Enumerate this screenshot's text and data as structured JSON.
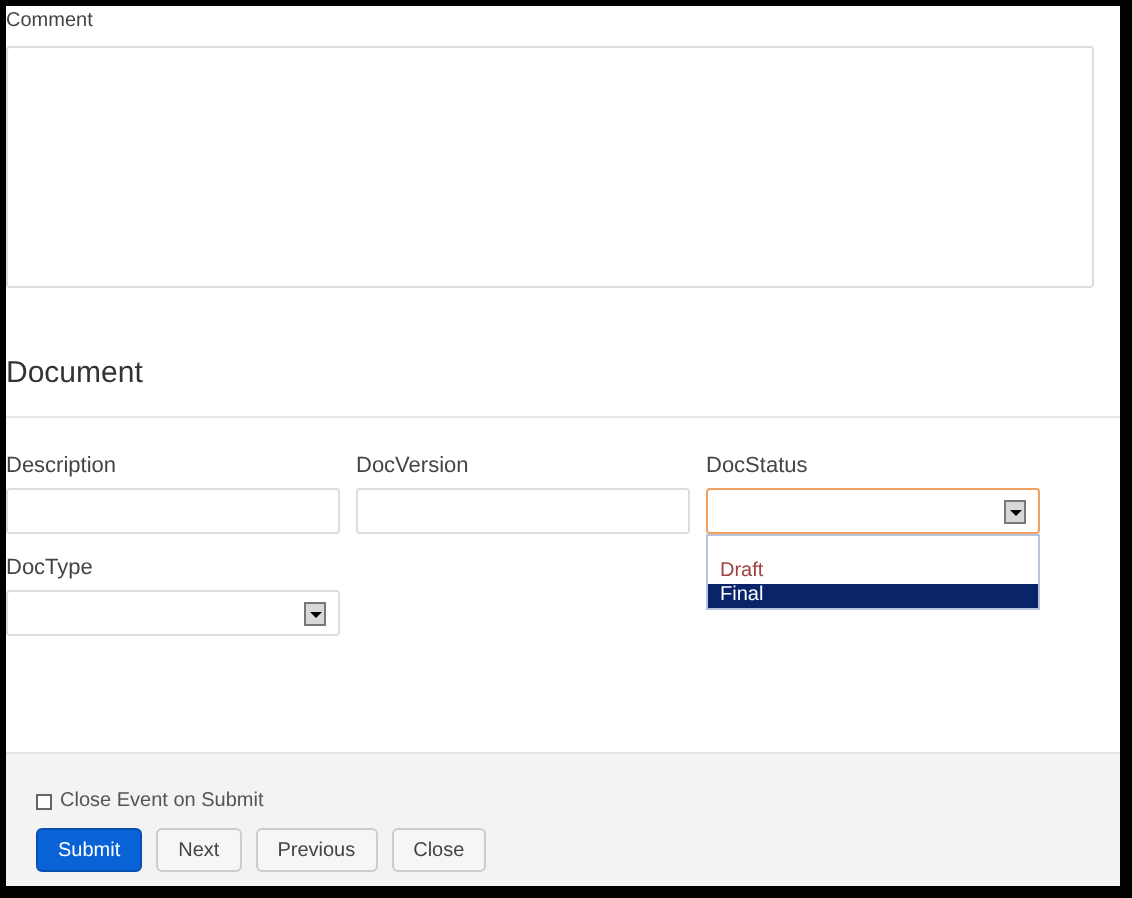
{
  "comment": {
    "label": "Comment"
  },
  "section": {
    "title": "Document"
  },
  "fields": [
    {
      "label": "Description",
      "kind": "text"
    },
    {
      "label": "DocVersion",
      "kind": "text"
    },
    {
      "label": "DocStatus",
      "kind": "select",
      "focused": true,
      "options": [
        {
          "label": "Draft",
          "selected": false
        },
        {
          "label": "Final",
          "selected": true
        }
      ]
    },
    {
      "label": "DocType",
      "kind": "select",
      "focused": false
    }
  ],
  "footer": {
    "checkbox": {
      "label": "Close Event on Submit",
      "checked": false
    },
    "buttons": [
      {
        "label": "Submit",
        "kind": "primary"
      },
      {
        "label": "Next",
        "kind": "default"
      },
      {
        "label": "Previous",
        "kind": "default"
      },
      {
        "label": "Close",
        "kind": "default"
      }
    ]
  }
}
